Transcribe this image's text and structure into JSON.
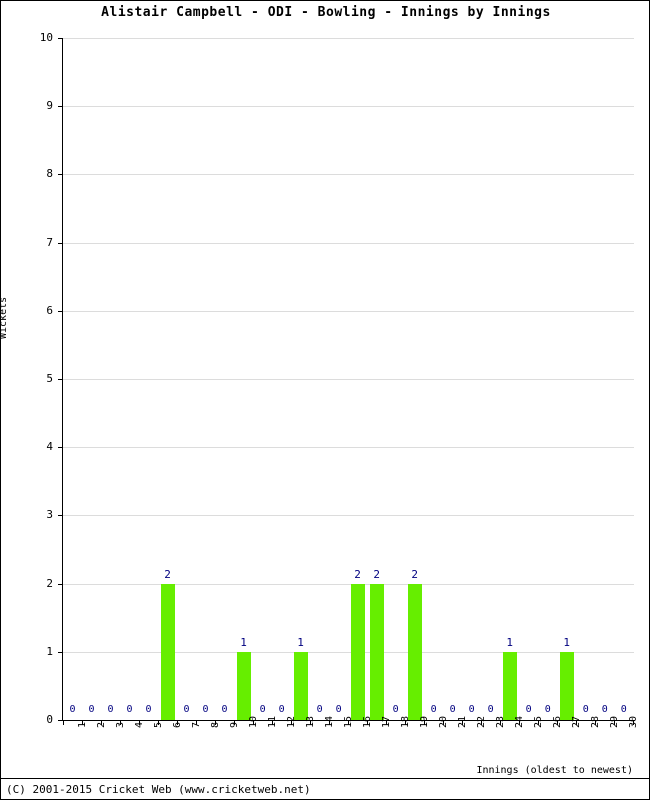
{
  "title": "Alistair Campbell - ODI - Bowling - Innings by Innings",
  "footer": "(C) 2001-2015 Cricket Web (www.cricketweb.net)",
  "axes": {
    "ylabel": "Wickets",
    "xlabel": "Innings (oldest to newest)",
    "yticks": [
      "0",
      "1",
      "2",
      "3",
      "4",
      "5",
      "6",
      "7",
      "8",
      "9",
      "10"
    ]
  },
  "colors": {
    "bar": "#66ee00",
    "value_label": "#000080",
    "grid": "#dcdcdc",
    "axis": "#000000",
    "background": "#ffffff"
  },
  "chart_data": {
    "type": "bar",
    "title": "Alistair Campbell - ODI - Bowling - Innings by Innings",
    "xlabel": "Innings (oldest to newest)",
    "ylabel": "Wickets",
    "ylim": [
      0,
      10
    ],
    "ytick_step": 1,
    "grid": true,
    "legend": "none",
    "bar_color": "#66ee00",
    "categories": [
      "1",
      "2",
      "3",
      "4",
      "5",
      "6",
      "7",
      "8",
      "9",
      "10",
      "11",
      "12",
      "13",
      "14",
      "15",
      "16",
      "17",
      "18",
      "19",
      "20",
      "21",
      "22",
      "23",
      "24",
      "25",
      "26",
      "27",
      "28",
      "29",
      "30"
    ],
    "values": [
      0,
      0,
      0,
      0,
      0,
      2,
      0,
      0,
      0,
      1,
      0,
      0,
      1,
      0,
      0,
      2,
      2,
      0,
      2,
      0,
      0,
      0,
      0,
      1,
      0,
      0,
      1,
      0,
      0,
      0
    ],
    "data_labels": [
      "0",
      "0",
      "0",
      "0",
      "0",
      "2",
      "0",
      "0",
      "0",
      "1",
      "0",
      "0",
      "1",
      "0",
      "0",
      "2",
      "2",
      "0",
      "2",
      "0",
      "0",
      "0",
      "0",
      "1",
      "0",
      "0",
      "1",
      "0",
      "0",
      "0"
    ]
  }
}
